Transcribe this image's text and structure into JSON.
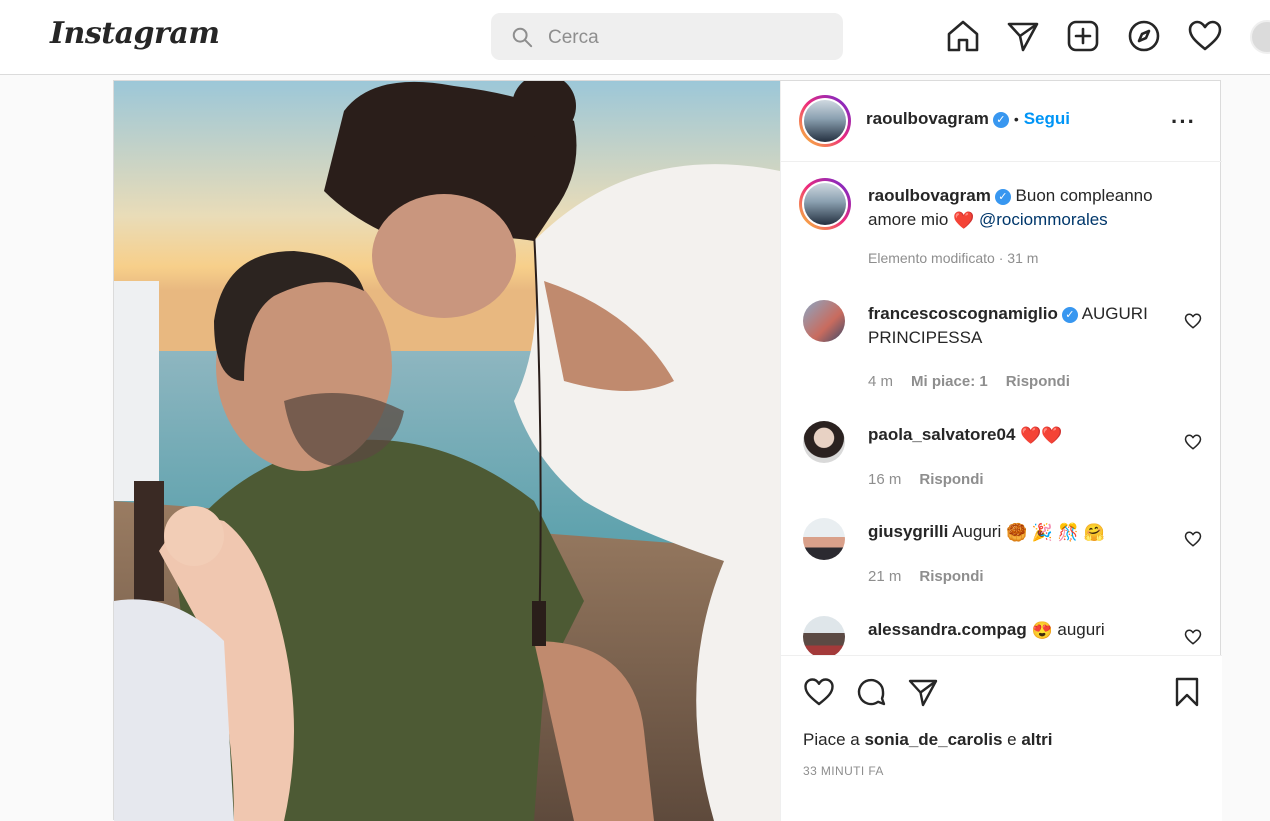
{
  "brand": {
    "logo_text": "Instagram"
  },
  "search": {
    "placeholder": "Cerca"
  },
  "nav": {
    "icons": [
      "home-icon",
      "direct-messages-icon",
      "new-post-icon",
      "explore-icon",
      "activity-heart-icon",
      "profile-avatar"
    ]
  },
  "post": {
    "author": {
      "username": "raoulbovagram",
      "verified": true,
      "follow_label": "Segui"
    },
    "caption": {
      "username": "raoulbovagram",
      "text": "Buon compleanno amore mio",
      "mention": "@rociommorales",
      "meta": "Elemento modificato · 31 m"
    },
    "comments": [
      {
        "username": "francescoscognamiglio",
        "verified": true,
        "text": "AUGURI PRINCIPESSA",
        "time": "4 m",
        "likes": "Mi piace: 1",
        "reply": "Rispondi"
      },
      {
        "username": "paola_salvatore04",
        "verified": false,
        "text": "",
        "time": "16 m",
        "likes": "",
        "reply": "Rispondi"
      },
      {
        "username": "giusygrilli",
        "verified": false,
        "text": "Auguri",
        "time": "21 m",
        "likes": "",
        "reply": "Rispondi"
      },
      {
        "username": "alessandra.compag",
        "verified": false,
        "text": "auguri",
        "time": "",
        "likes": "",
        "reply": ""
      }
    ],
    "liked_by": {
      "prefix": "Piace a",
      "user": "sonia_de_carolis",
      "joiner": "e",
      "others": "altri"
    },
    "timestamp": "33 MINUTI FA"
  },
  "colors": {
    "accent": "#0095f6",
    "verified": "#3897f0",
    "muted": "#8e8e8e",
    "border": "#dbdbdb"
  }
}
